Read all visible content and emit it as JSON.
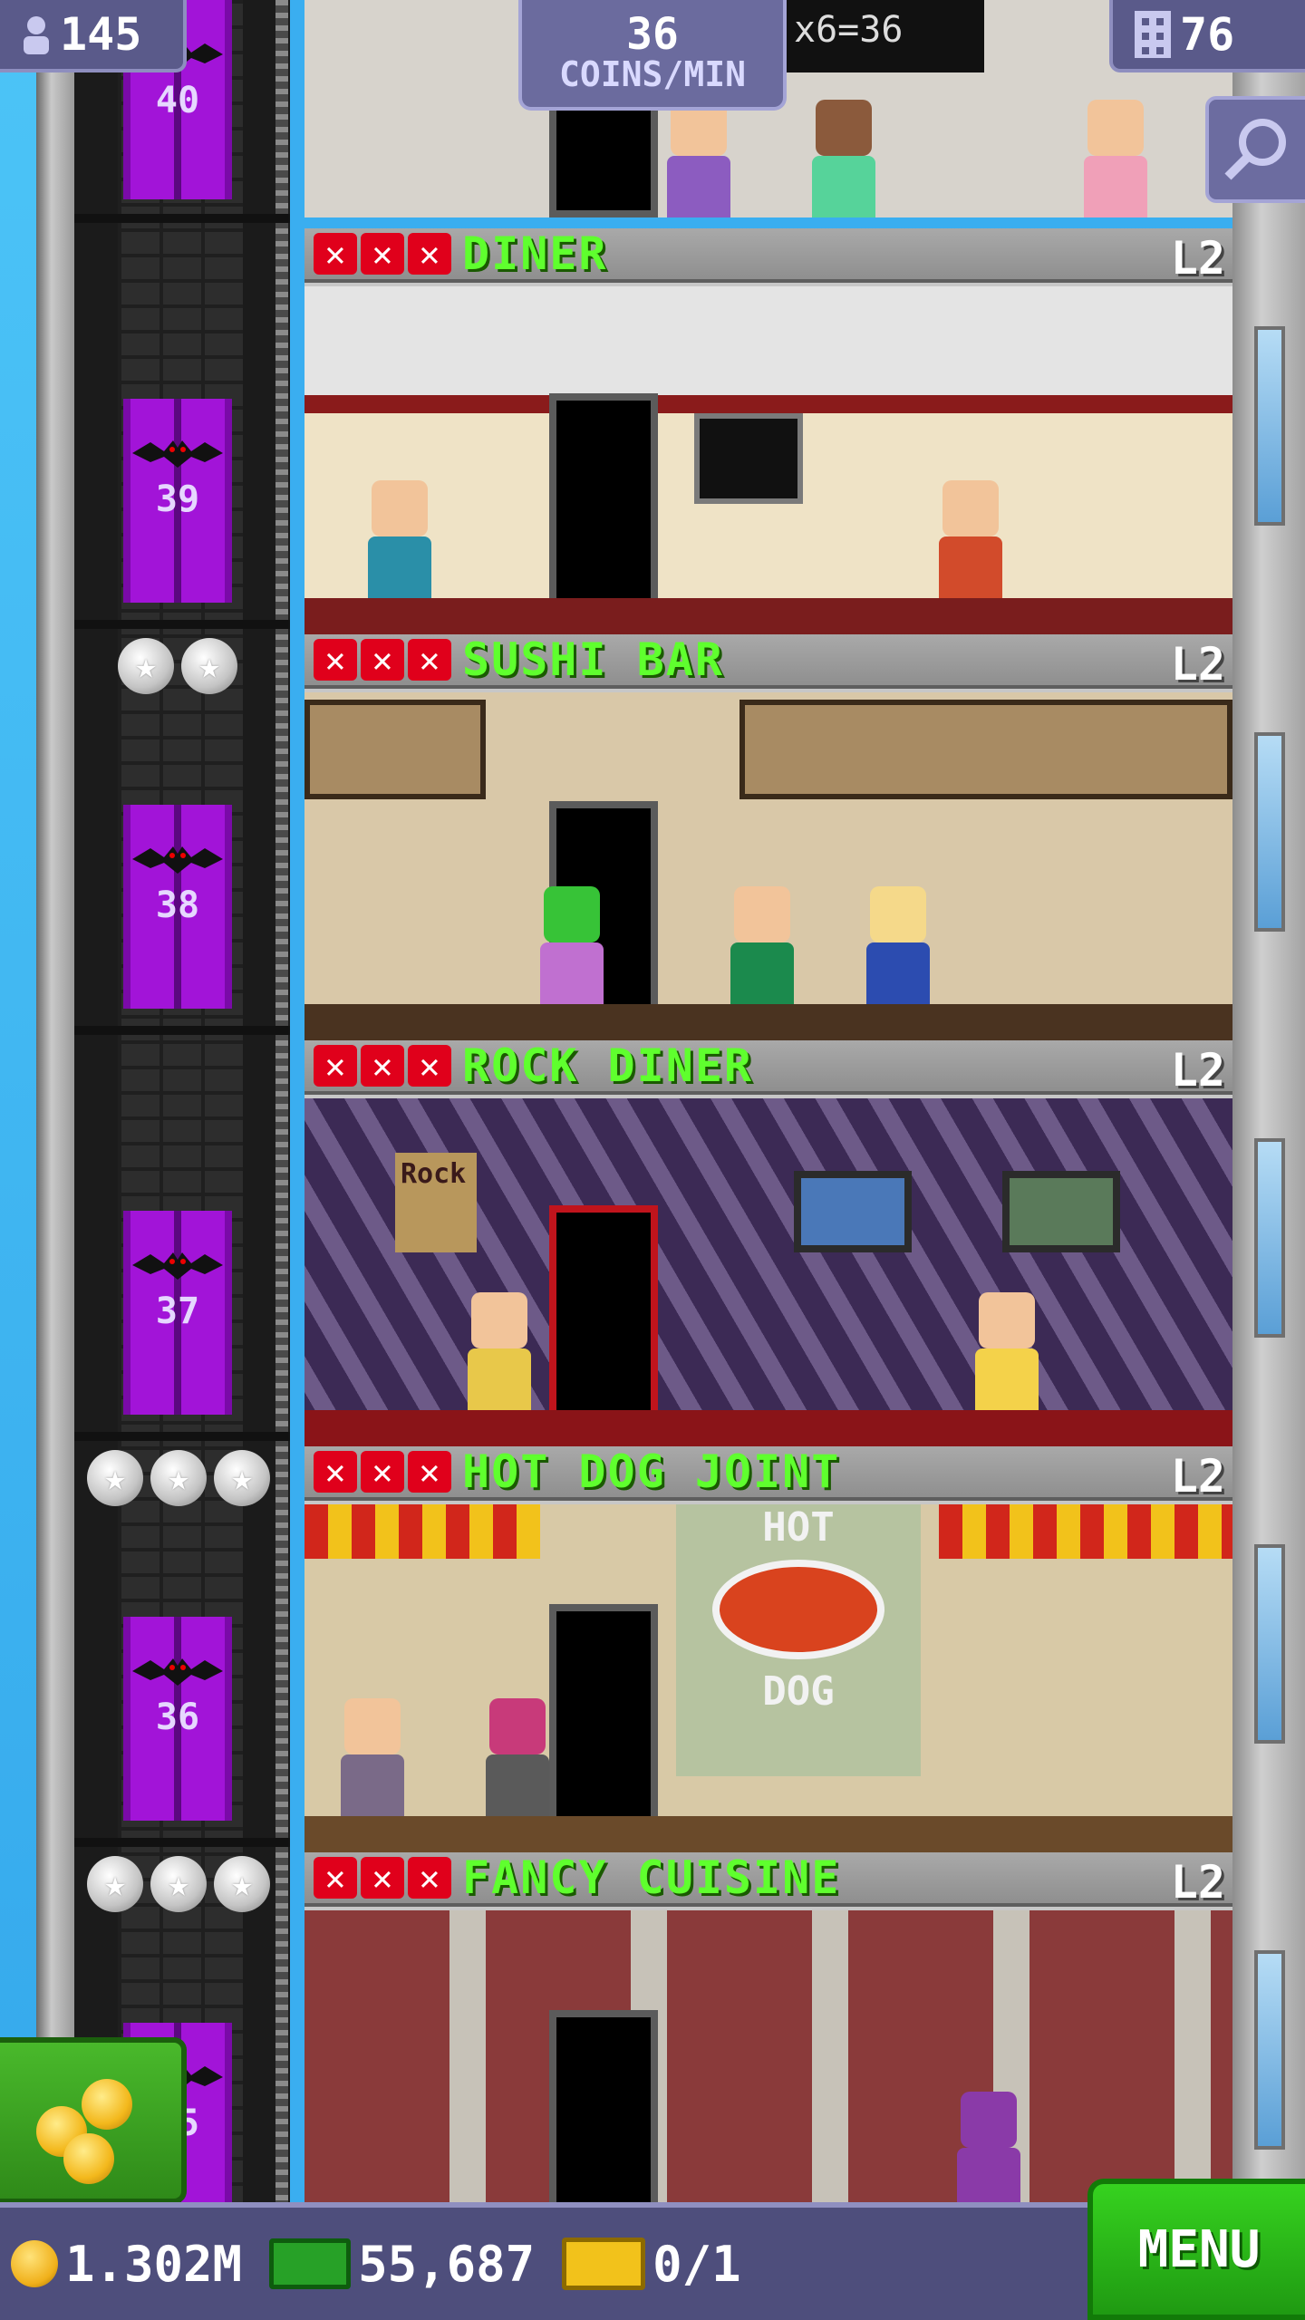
{
  "top_bar": {
    "population": "145",
    "coins_per_min_value": "36",
    "coins_per_min_label": "COINS/MIN",
    "floors": "76"
  },
  "elevator_floors": [
    "40",
    "39",
    "38",
    "37",
    "36",
    "35"
  ],
  "floors": [
    {
      "name": "DINER",
      "level": "L2",
      "stars": 0
    },
    {
      "name": "SUSHI BAR",
      "level": "L2",
      "stars": 2
    },
    {
      "name": "ROCK DINER",
      "level": "L2",
      "stars": 0
    },
    {
      "name": "HOT DOG JOINT",
      "level": "L2",
      "stars": 3
    },
    {
      "name": "FANCY CUISINE",
      "level": "L2",
      "stars": 3
    }
  ],
  "scene_text": {
    "hot_dog_sign_top": "HOT",
    "hot_dog_sign_bottom": "DOG",
    "chalkboard": "x6=36",
    "rock_sign": "Rock"
  },
  "bottom_bar": {
    "coins": "1.302M",
    "bux": "55,687",
    "tickets": "0/1",
    "menu_label": "MENU"
  },
  "colors": {
    "room_name": "#5fff2e",
    "elevator": "#a214d8",
    "x_mark": "#e0001b",
    "menu_button": "#2fbf1a"
  },
  "icons": [
    "person-icon",
    "building-icon",
    "magnify-icon",
    "coin-icon",
    "bux-icon",
    "ticket-icon",
    "bat-icon",
    "star-icon"
  ]
}
